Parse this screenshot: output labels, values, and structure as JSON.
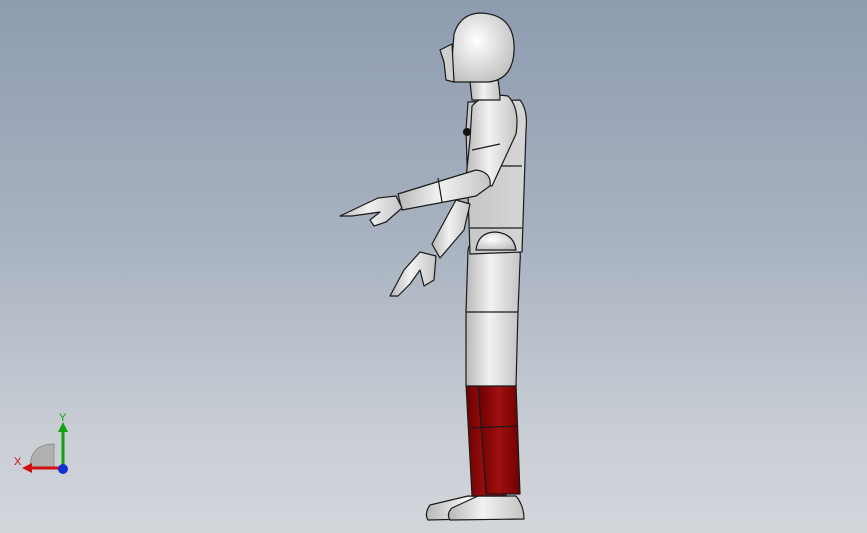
{
  "viewport": {
    "background_top": "#8e9cb0",
    "background_bottom": "#d3d6db",
    "model_colors": {
      "body": "#d8d8d8",
      "shin": "#8b0000",
      "outline": "#1a1a1a"
    }
  },
  "triad": {
    "x_label": "X",
    "y_label": "Y",
    "x_color": "#d01010",
    "y_color": "#10a010",
    "z_color": "#1030d0"
  }
}
